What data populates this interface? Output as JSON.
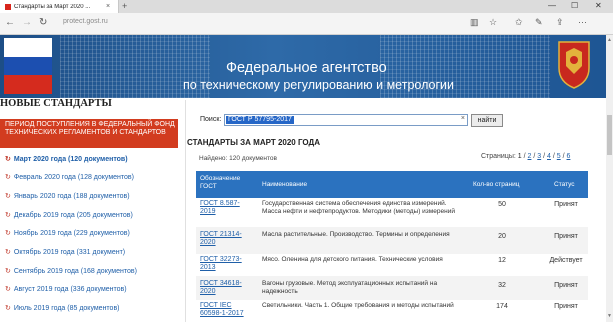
{
  "browser": {
    "tab_title": "Стандарты за Март 2020 ...",
    "tab_close": "×",
    "new_tab": "+",
    "address": "protect.gost.ru",
    "window_buttons": [
      "—",
      "☐",
      "✕"
    ],
    "nav_icons": [
      "back-icon",
      "forward-icon",
      "refresh-icon"
    ],
    "right_icons": [
      "reading-view-icon",
      "favorite-star-icon",
      "favorites-hub-icon",
      "pen-icon",
      "share-icon",
      "more-icon"
    ]
  },
  "banner": {
    "line1": "Федеральное агентство",
    "line2": "по техническому регулированию и метрологии",
    "colors": {
      "primary": "#1d4e86",
      "flag": [
        "#ffffff",
        "#1c4fb0",
        "#d52b1e"
      ]
    }
  },
  "sidebar": {
    "title": "НОВЫЕ СТАНДАРТЫ",
    "red_box": "ПЕРИОД ПОСТУПЛЕНИЯ В ФЕДЕРАЛЬНЫЙ ФОНД ТЕХНИЧЕСКИХ РЕГЛАМЕНТОВ И СТАНДАРТОВ",
    "items": [
      {
        "label": "Март 2020 года (120 документов)",
        "active": true
      },
      {
        "label": "Февраль 2020 года (128 документов)"
      },
      {
        "label": "Январь 2020 года (188 документов)"
      },
      {
        "label": "Декабрь 2019 года (205 документов)"
      },
      {
        "label": "Ноябрь 2019 года (229 документов)"
      },
      {
        "label": "Октябрь 2019 года (331 документ)"
      },
      {
        "label": "Сентябрь 2019 года (168 документов)"
      },
      {
        "label": "Август 2019 года (336 документов)"
      },
      {
        "label": "Июль 2019 года (85 документов)"
      }
    ]
  },
  "search": {
    "label": "Поиск:",
    "value": "ГОСТ Р 57795-2017",
    "clear": "×",
    "button": "найти"
  },
  "main": {
    "heading": "СТАНДАРТЫ ЗА МАРТ 2020 ГОДА",
    "found": "Найдено: 120 документов",
    "pages_label": "Страницы:",
    "pages": [
      "1",
      "2",
      "3",
      "4",
      "5",
      "6"
    ],
    "current_page": "1"
  },
  "table": {
    "columns": [
      "Обозначение ГОСТ",
      "Наименование",
      "Кол-во страниц",
      "Статус"
    ],
    "rows": [
      {
        "code": "ГОСТ 8.587-2019",
        "name": "Государственная система обеспечения единства измерений. Масса нефти и нефтепродуктов. Методики (методы) измерений",
        "pages": "50",
        "status": "Принят"
      },
      {
        "code": "ГОСТ 21314-2020",
        "name": "Масла растительные. Производство. Термины и определения",
        "pages": "20",
        "status": "Принят"
      },
      {
        "code": "ГОСТ 32273-2013",
        "name": "Мясо. Оленина для детского питания. Технические условия",
        "pages": "12",
        "status": "Действует"
      },
      {
        "code": "ГОСТ 34618-2020",
        "name": "Вагоны грузовые. Метод эксплуатационных испытаний на надежность",
        "pages": "32",
        "status": "Принят"
      },
      {
        "code": "ГОСТ IEC 60598-1-2017",
        "name": "Светильники. Часть 1. Общие требования и методы испытаний",
        "pages": "174",
        "status": "Принят"
      }
    ]
  }
}
